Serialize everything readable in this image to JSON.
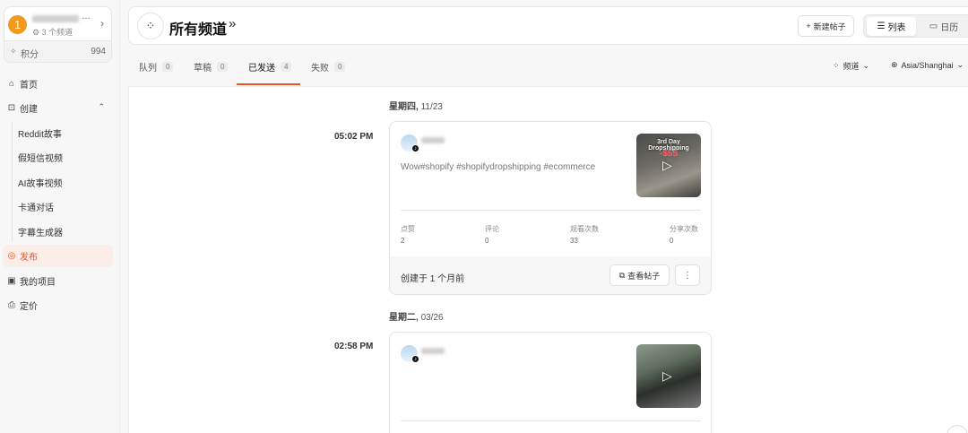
{
  "sidebar": {
    "account": {
      "initial": "1",
      "name_suffix": "…",
      "subtitle": "3 个频道"
    },
    "credits": {
      "label": "积分",
      "value": "994"
    },
    "items": [
      {
        "label": "首页",
        "icon": "home-icon"
      },
      {
        "label": "创建",
        "icon": "create-icon"
      },
      {
        "label": "Reddit故事"
      },
      {
        "label": "假短信视频"
      },
      {
        "label": "AI故事视频"
      },
      {
        "label": "卡通对话"
      },
      {
        "label": "字幕生成器"
      },
      {
        "label": "发布",
        "icon": "publish-icon"
      },
      {
        "label": "我的项目",
        "icon": "projects-icon"
      },
      {
        "label": "定价",
        "icon": "pricing-icon"
      }
    ]
  },
  "header": {
    "title": "所有频道",
    "new_post": "新建帖子",
    "view_list": "列表",
    "view_calendar": "日历"
  },
  "tabs": [
    {
      "label": "队列",
      "count": "0"
    },
    {
      "label": "草稿",
      "count": "0"
    },
    {
      "label": "已发送",
      "count": "4"
    },
    {
      "label": "失败",
      "count": "0"
    }
  ],
  "filters": {
    "channel": "频道",
    "timezone": "Asia/Shanghai"
  },
  "posts": [
    {
      "day": "星期四,",
      "date": "11/23",
      "time": "05:02 PM",
      "caption": "Wow#shopify #shopifydropshipping #ecommerce",
      "thumb_title": "3rd Day Dropshipping",
      "thumb_price": "-$55",
      "stats": [
        {
          "label": "点赞",
          "value": "2"
        },
        {
          "label": "评论",
          "value": "0"
        },
        {
          "label": "观看次数",
          "value": "33"
        },
        {
          "label": "分享次数",
          "value": "0"
        }
      ],
      "created": "创建于 1 个月前",
      "view_button": "查看帖子"
    },
    {
      "day": "星期二,",
      "date": "03/26",
      "time": "02:58 PM"
    }
  ],
  "colors": {
    "accent": "#e8542b",
    "avatar": "#f29a1e"
  }
}
